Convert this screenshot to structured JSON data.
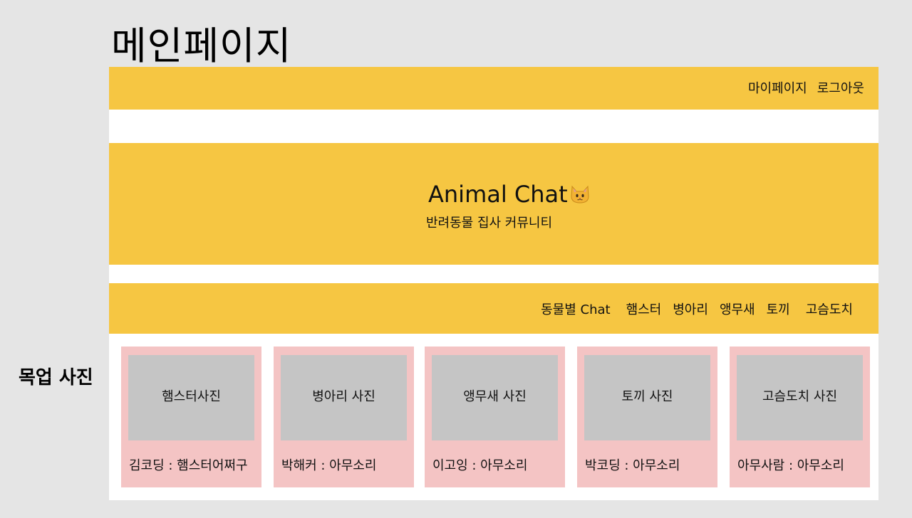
{
  "page_title": "메인페이지",
  "side_label": "목업 사진",
  "topbar": {
    "links": [
      "마이페이지",
      "로그아웃"
    ]
  },
  "hero": {
    "title": "Animal Chat",
    "title_icon": "cat-face-icon",
    "subtitle": "반려동물 집사 커뮤니티"
  },
  "nav": {
    "label": "동물별 Chat",
    "items": [
      "햄스터",
      "병아리",
      "앵무새",
      "토끼",
      "고슴도치"
    ]
  },
  "cards": [
    {
      "photo_label": "햄스터사진",
      "caption": "김코딩 : 햄스터어쩌구"
    },
    {
      "photo_label": "병아리 사진",
      "caption": "박해커 : 아무소리"
    },
    {
      "photo_label": "앵무새 사진",
      "caption": "이고잉 : 아무소리"
    },
    {
      "photo_label": "토끼 사진",
      "caption": "박코딩 : 아무소리"
    },
    {
      "photo_label": "고슴도치 사진",
      "caption": "아무사람 : 아무소리"
    }
  ],
  "colors": {
    "background": "#e5e5e5",
    "accent_yellow": "#f6c642",
    "card_pink": "#f4c4c4",
    "photo_gray": "#c5c5c5"
  }
}
